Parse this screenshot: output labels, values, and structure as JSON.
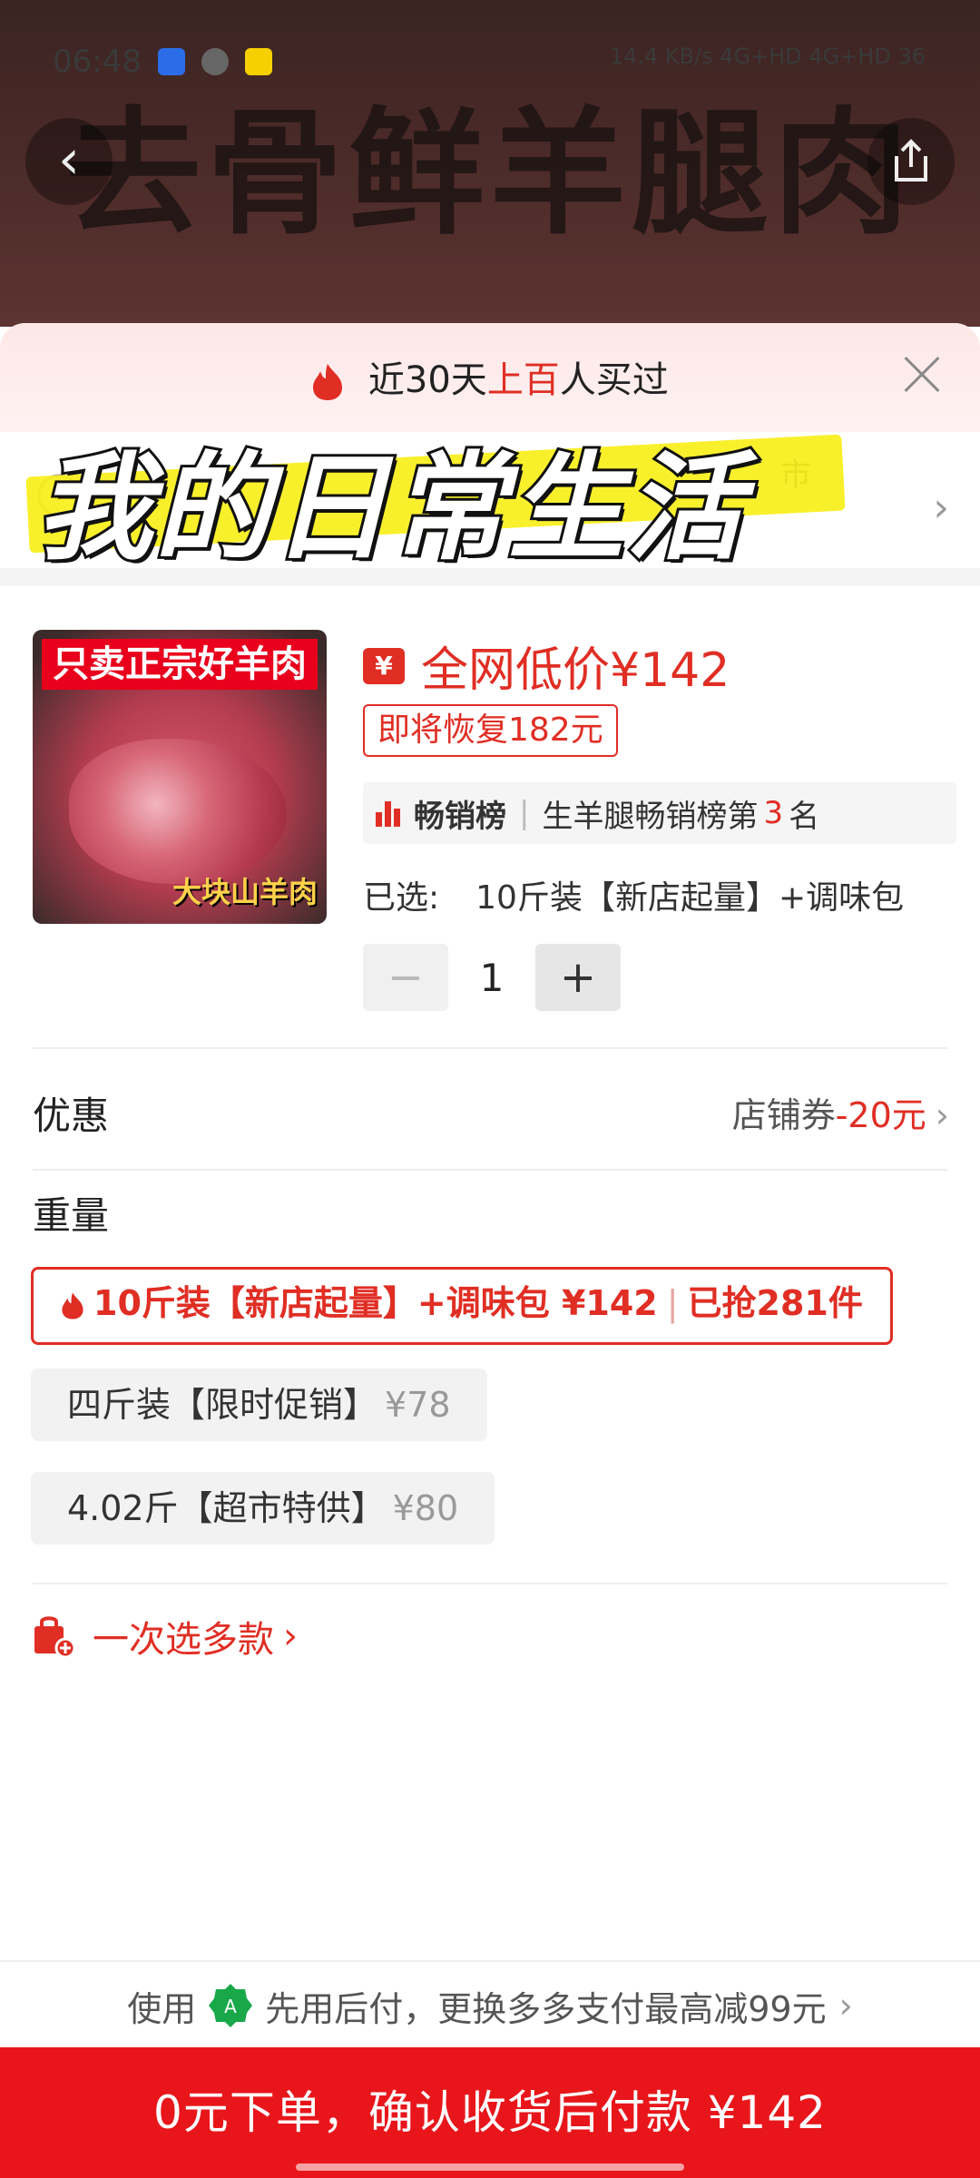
{
  "hero": {
    "banner_text": "去骨鲜羊腿肉",
    "status_time": "06:48",
    "status_right": "14.4 KB/s  4G+HD 4G+HD  36"
  },
  "sold": {
    "prefix": "近30天",
    "highlight": "上百",
    "suffix": "人买过"
  },
  "address": {
    "line1": "市",
    "line2": ""
  },
  "overlay": {
    "text": "我的日常生活"
  },
  "product": {
    "image_top_tag": "只卖正宗好羊肉",
    "image_bottom_tag": "大块山羊肉",
    "price_text": "全网低价¥142",
    "price_badge": "¥",
    "restore_text": "即将恢复182元",
    "rank_title": "畅销榜",
    "rank_desc": "生羊腿畅销榜第",
    "rank_num": "3",
    "rank_suffix": "名",
    "selected_label": "已选:",
    "selected_value": "10斤装【新店起量】+调味包",
    "quantity": "1",
    "minus": "−",
    "plus": "+"
  },
  "discount": {
    "label": "优惠",
    "prefix": "店铺券",
    "value": "-20元",
    "chevron": "›"
  },
  "weight": {
    "label": "重量",
    "options": [
      {
        "name": "10斤装【新店起量】+调味包",
        "price": "¥142",
        "sold": "已抢281件"
      },
      {
        "name": "四斤装【限时促销】",
        "price": "¥78"
      },
      {
        "name": "4.02斤【超市特供】",
        "price": "¥80"
      }
    ]
  },
  "multi": {
    "label": "一次选多款",
    "chevron": "›"
  },
  "pay": {
    "use": "使用",
    "desc": "先用后付，更换多多支付最高减99元",
    "chevron": "›"
  },
  "cta": {
    "label": "0元下单，确认收货后付款 ¥142"
  },
  "colors": {
    "accent": "#e02e24",
    "cta_bg": "#e8161b",
    "highlight": "#f9ef1a"
  }
}
